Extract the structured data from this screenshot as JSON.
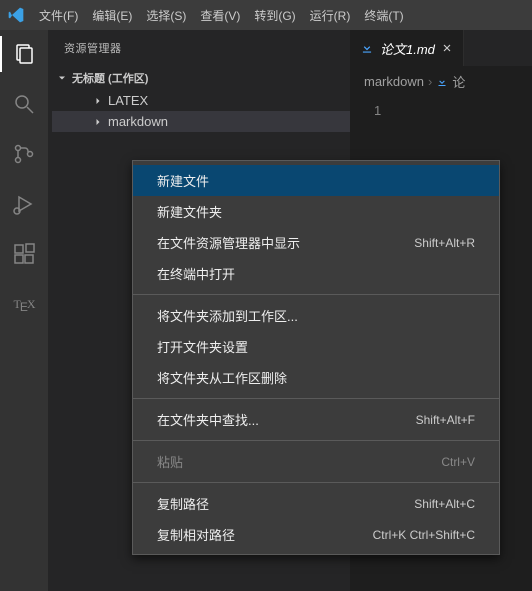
{
  "menubar": {
    "items": [
      "文件(F)",
      "编辑(E)",
      "选择(S)",
      "查看(V)",
      "转到(G)",
      "运行(R)",
      "终端(T)"
    ]
  },
  "sidebar": {
    "title": "资源管理器",
    "workspace_label": "无标题 (工作区)",
    "tree": [
      {
        "label": "LATEX",
        "indent": 1,
        "expanded": false,
        "sel": false
      },
      {
        "label": "markdown",
        "indent": 1,
        "expanded": false,
        "sel": true
      }
    ]
  },
  "tab": {
    "icon": "download-icon",
    "label": "论文1.md"
  },
  "breadcrumbs": {
    "segments": [
      "markdown",
      "论"
    ]
  },
  "editor": {
    "line_number": "1"
  },
  "context_menu": {
    "groups": [
      [
        {
          "label": "新建文件",
          "shortcut": "",
          "hover": true
        },
        {
          "label": "新建文件夹",
          "shortcut": ""
        },
        {
          "label": "在文件资源管理器中显示",
          "shortcut": "Shift+Alt+R"
        },
        {
          "label": "在终端中打开",
          "shortcut": ""
        }
      ],
      [
        {
          "label": "将文件夹添加到工作区...",
          "shortcut": ""
        },
        {
          "label": "打开文件夹设置",
          "shortcut": ""
        },
        {
          "label": "将文件夹从工作区删除",
          "shortcut": ""
        }
      ],
      [
        {
          "label": "在文件夹中查找...",
          "shortcut": "Shift+Alt+F"
        }
      ],
      [
        {
          "label": "粘贴",
          "shortcut": "Ctrl+V",
          "disabled": true
        }
      ],
      [
        {
          "label": "复制路径",
          "shortcut": "Shift+Alt+C"
        },
        {
          "label": "复制相对路径",
          "shortcut": "Ctrl+K Ctrl+Shift+C"
        }
      ]
    ]
  }
}
